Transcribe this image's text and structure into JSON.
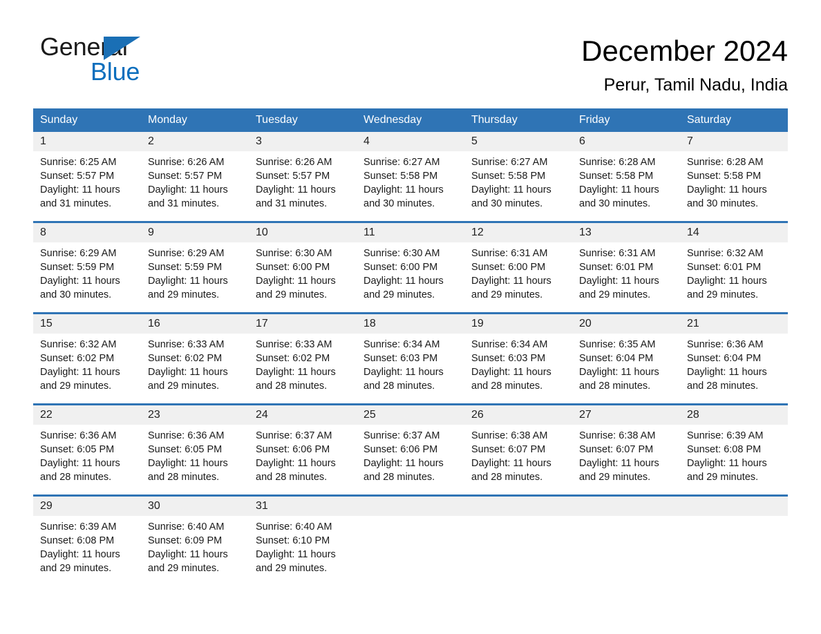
{
  "brand": {
    "name_part1": "General",
    "name_part2": "Blue",
    "triangle_color": "#1a6fb5"
  },
  "header": {
    "month_title": "December 2024",
    "location": "Perur, Tamil Nadu, India"
  },
  "calendar": {
    "accent_color": "#2f74b5",
    "daynum_band_color": "#f0f0f0",
    "weekday_headers": [
      "Sunday",
      "Monday",
      "Tuesday",
      "Wednesday",
      "Thursday",
      "Friday",
      "Saturday"
    ],
    "weeks": [
      [
        {
          "day": "1",
          "sunrise": "Sunrise: 6:25 AM",
          "sunset": "Sunset: 5:57 PM",
          "daylight": "Daylight: 11 hours and 31 minutes."
        },
        {
          "day": "2",
          "sunrise": "Sunrise: 6:26 AM",
          "sunset": "Sunset: 5:57 PM",
          "daylight": "Daylight: 11 hours and 31 minutes."
        },
        {
          "day": "3",
          "sunrise": "Sunrise: 6:26 AM",
          "sunset": "Sunset: 5:57 PM",
          "daylight": "Daylight: 11 hours and 31 minutes."
        },
        {
          "day": "4",
          "sunrise": "Sunrise: 6:27 AM",
          "sunset": "Sunset: 5:58 PM",
          "daylight": "Daylight: 11 hours and 30 minutes."
        },
        {
          "day": "5",
          "sunrise": "Sunrise: 6:27 AM",
          "sunset": "Sunset: 5:58 PM",
          "daylight": "Daylight: 11 hours and 30 minutes."
        },
        {
          "day": "6",
          "sunrise": "Sunrise: 6:28 AM",
          "sunset": "Sunset: 5:58 PM",
          "daylight": "Daylight: 11 hours and 30 minutes."
        },
        {
          "day": "7",
          "sunrise": "Sunrise: 6:28 AM",
          "sunset": "Sunset: 5:58 PM",
          "daylight": "Daylight: 11 hours and 30 minutes."
        }
      ],
      [
        {
          "day": "8",
          "sunrise": "Sunrise: 6:29 AM",
          "sunset": "Sunset: 5:59 PM",
          "daylight": "Daylight: 11 hours and 30 minutes."
        },
        {
          "day": "9",
          "sunrise": "Sunrise: 6:29 AM",
          "sunset": "Sunset: 5:59 PM",
          "daylight": "Daylight: 11 hours and 29 minutes."
        },
        {
          "day": "10",
          "sunrise": "Sunrise: 6:30 AM",
          "sunset": "Sunset: 6:00 PM",
          "daylight": "Daylight: 11 hours and 29 minutes."
        },
        {
          "day": "11",
          "sunrise": "Sunrise: 6:30 AM",
          "sunset": "Sunset: 6:00 PM",
          "daylight": "Daylight: 11 hours and 29 minutes."
        },
        {
          "day": "12",
          "sunrise": "Sunrise: 6:31 AM",
          "sunset": "Sunset: 6:00 PM",
          "daylight": "Daylight: 11 hours and 29 minutes."
        },
        {
          "day": "13",
          "sunrise": "Sunrise: 6:31 AM",
          "sunset": "Sunset: 6:01 PM",
          "daylight": "Daylight: 11 hours and 29 minutes."
        },
        {
          "day": "14",
          "sunrise": "Sunrise: 6:32 AM",
          "sunset": "Sunset: 6:01 PM",
          "daylight": "Daylight: 11 hours and 29 minutes."
        }
      ],
      [
        {
          "day": "15",
          "sunrise": "Sunrise: 6:32 AM",
          "sunset": "Sunset: 6:02 PM",
          "daylight": "Daylight: 11 hours and 29 minutes."
        },
        {
          "day": "16",
          "sunrise": "Sunrise: 6:33 AM",
          "sunset": "Sunset: 6:02 PM",
          "daylight": "Daylight: 11 hours and 29 minutes."
        },
        {
          "day": "17",
          "sunrise": "Sunrise: 6:33 AM",
          "sunset": "Sunset: 6:02 PM",
          "daylight": "Daylight: 11 hours and 28 minutes."
        },
        {
          "day": "18",
          "sunrise": "Sunrise: 6:34 AM",
          "sunset": "Sunset: 6:03 PM",
          "daylight": "Daylight: 11 hours and 28 minutes."
        },
        {
          "day": "19",
          "sunrise": "Sunrise: 6:34 AM",
          "sunset": "Sunset: 6:03 PM",
          "daylight": "Daylight: 11 hours and 28 minutes."
        },
        {
          "day": "20",
          "sunrise": "Sunrise: 6:35 AM",
          "sunset": "Sunset: 6:04 PM",
          "daylight": "Daylight: 11 hours and 28 minutes."
        },
        {
          "day": "21",
          "sunrise": "Sunrise: 6:36 AM",
          "sunset": "Sunset: 6:04 PM",
          "daylight": "Daylight: 11 hours and 28 minutes."
        }
      ],
      [
        {
          "day": "22",
          "sunrise": "Sunrise: 6:36 AM",
          "sunset": "Sunset: 6:05 PM",
          "daylight": "Daylight: 11 hours and 28 minutes."
        },
        {
          "day": "23",
          "sunrise": "Sunrise: 6:36 AM",
          "sunset": "Sunset: 6:05 PM",
          "daylight": "Daylight: 11 hours and 28 minutes."
        },
        {
          "day": "24",
          "sunrise": "Sunrise: 6:37 AM",
          "sunset": "Sunset: 6:06 PM",
          "daylight": "Daylight: 11 hours and 28 minutes."
        },
        {
          "day": "25",
          "sunrise": "Sunrise: 6:37 AM",
          "sunset": "Sunset: 6:06 PM",
          "daylight": "Daylight: 11 hours and 28 minutes."
        },
        {
          "day": "26",
          "sunrise": "Sunrise: 6:38 AM",
          "sunset": "Sunset: 6:07 PM",
          "daylight": "Daylight: 11 hours and 28 minutes."
        },
        {
          "day": "27",
          "sunrise": "Sunrise: 6:38 AM",
          "sunset": "Sunset: 6:07 PM",
          "daylight": "Daylight: 11 hours and 29 minutes."
        },
        {
          "day": "28",
          "sunrise": "Sunrise: 6:39 AM",
          "sunset": "Sunset: 6:08 PM",
          "daylight": "Daylight: 11 hours and 29 minutes."
        }
      ],
      [
        {
          "day": "29",
          "sunrise": "Sunrise: 6:39 AM",
          "sunset": "Sunset: 6:08 PM",
          "daylight": "Daylight: 11 hours and 29 minutes."
        },
        {
          "day": "30",
          "sunrise": "Sunrise: 6:40 AM",
          "sunset": "Sunset: 6:09 PM",
          "daylight": "Daylight: 11 hours and 29 minutes."
        },
        {
          "day": "31",
          "sunrise": "Sunrise: 6:40 AM",
          "sunset": "Sunset: 6:10 PM",
          "daylight": "Daylight: 11 hours and 29 minutes."
        },
        {
          "day": "",
          "sunrise": "",
          "sunset": "",
          "daylight": ""
        },
        {
          "day": "",
          "sunrise": "",
          "sunset": "",
          "daylight": ""
        },
        {
          "day": "",
          "sunrise": "",
          "sunset": "",
          "daylight": ""
        },
        {
          "day": "",
          "sunrise": "",
          "sunset": "",
          "daylight": ""
        }
      ]
    ]
  }
}
